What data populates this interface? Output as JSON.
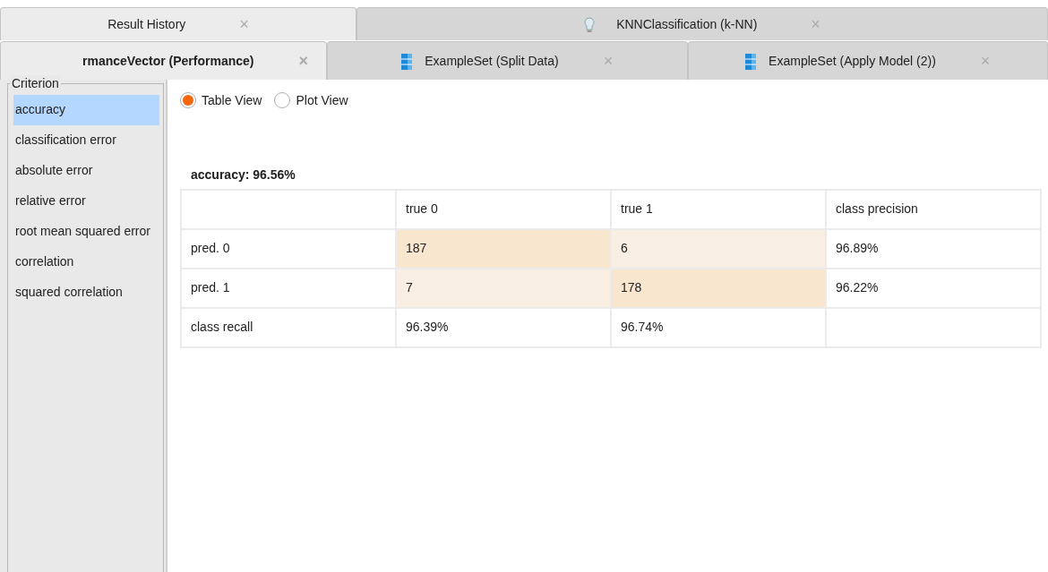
{
  "tab_rows": [
    [
      {
        "label": "Result History",
        "selected": true,
        "kind": "plain",
        "close": "×"
      },
      {
        "label": "KNNClassification (k-NN)",
        "selected": false,
        "kind": "model",
        "close": "×"
      }
    ],
    [
      {
        "label": "rmanceVector (Performance)",
        "selected": true,
        "kind": "plain",
        "close": "×"
      },
      {
        "label": "ExampleSet (Split Data)",
        "selected": false,
        "kind": "data",
        "close": "×"
      },
      {
        "label": "ExampleSet (Apply Model (2))",
        "selected": false,
        "kind": "data",
        "close": "×"
      }
    ]
  ],
  "criterion": {
    "title": "Criterion",
    "items": [
      {
        "label": "accuracy",
        "selected": true
      },
      {
        "label": "classification error",
        "selected": false
      },
      {
        "label": "absolute error",
        "selected": false
      },
      {
        "label": "relative error",
        "selected": false
      },
      {
        "label": "root mean squared error",
        "selected": false
      },
      {
        "label": "correlation",
        "selected": false
      },
      {
        "label": "squared correlation",
        "selected": false
      }
    ]
  },
  "views": [
    {
      "label": "Table View",
      "selected": true
    },
    {
      "label": "Plot View",
      "selected": false
    }
  ],
  "result_title": "accuracy: 96.56%",
  "table": {
    "columns": [
      "true 0",
      "true 1",
      "class precision"
    ],
    "rows": [
      {
        "label": "pred. 0",
        "cells": [
          {
            "text": "187",
            "color": "#f9e6cf"
          },
          {
            "text": "6",
            "color": "#f8eee2"
          },
          {
            "text": "96.89%"
          }
        ]
      },
      {
        "label": "pred. 1",
        "cells": [
          {
            "text": "7",
            "color": "#f8eee2"
          },
          {
            "text": "178",
            "color": "#f9e6cf"
          },
          {
            "text": "96.22%"
          }
        ]
      },
      {
        "label": "class recall",
        "cells": [
          {
            "text": "96.39%"
          },
          {
            "text": "96.74%"
          }
        ]
      }
    ]
  }
}
